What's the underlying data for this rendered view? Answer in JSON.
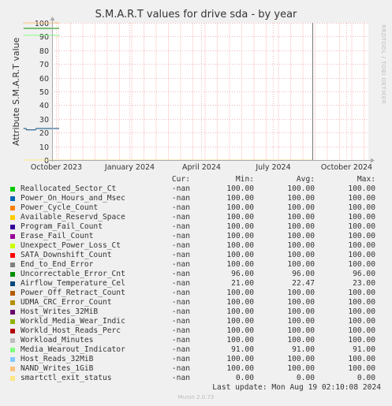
{
  "chart_data": {
    "type": "line",
    "title": "S.M.A.R.T values for drive sda - by year",
    "ylabel": "Attribute S.M.A.R.T value",
    "side_label": "RRDTOOL / TOBI OETIKER",
    "ylim": [
      0,
      100
    ],
    "yticks": [
      "0",
      "10",
      "20",
      "30",
      "40",
      "50",
      "60",
      "70",
      "80",
      "90",
      "100"
    ],
    "x_tick_labels": [
      {
        "date": "2023-10-01",
        "label": "October 2023"
      },
      {
        "date": "2024-01-01",
        "label": "January 2024"
      },
      {
        "date": "2024-04-01",
        "label": "April 2024"
      },
      {
        "date": "2024-07-01",
        "label": "July 2024"
      },
      {
        "date": "2024-10-01",
        "label": "October 2024"
      }
    ],
    "xlim": [
      "2023-08-21",
      "2024-08-19"
    ],
    "grid": true,
    "vertical_marker_date": "2024-08-19",
    "series": [
      {
        "name": "Reallocated_Sector_Ct",
        "color": "#00cc00",
        "cur": "-nan",
        "min": "100.00",
        "avg": "100.00",
        "max": "100.00",
        "points": [
          [
            "2023-08-21",
            100
          ],
          [
            "2023-10-05",
            100
          ]
        ]
      },
      {
        "name": "Power_On_Hours_and_Msec",
        "color": "#0066b3",
        "cur": "-nan",
        "min": "100.00",
        "avg": "100.00",
        "max": "100.00",
        "points": [
          [
            "2023-08-21",
            100
          ],
          [
            "2023-10-05",
            100
          ]
        ]
      },
      {
        "name": "Power_Cycle_Count",
        "color": "#ff8000",
        "cur": "-nan",
        "min": "100.00",
        "avg": "100.00",
        "max": "100.00",
        "points": [
          [
            "2023-08-21",
            100
          ],
          [
            "2023-10-05",
            100
          ]
        ]
      },
      {
        "name": "Available_Reservd_Space",
        "color": "#ffcc00",
        "cur": "-nan",
        "min": "100.00",
        "avg": "100.00",
        "max": "100.00",
        "points": [
          [
            "2023-08-21",
            100
          ],
          [
            "2023-10-05",
            100
          ]
        ]
      },
      {
        "name": "Program_Fail_Count",
        "color": "#330099",
        "cur": "-nan",
        "min": "100.00",
        "avg": "100.00",
        "max": "100.00",
        "points": [
          [
            "2023-08-21",
            100
          ],
          [
            "2023-10-05",
            100
          ]
        ]
      },
      {
        "name": "Erase_Fail_Count",
        "color": "#990099",
        "cur": "-nan",
        "min": "100.00",
        "avg": "100.00",
        "max": "100.00",
        "points": [
          [
            "2023-08-21",
            100
          ],
          [
            "2023-10-05",
            100
          ]
        ]
      },
      {
        "name": "Unexpect_Power_Loss_Ct",
        "color": "#ccff00",
        "cur": "-nan",
        "min": "100.00",
        "avg": "100.00",
        "max": "100.00",
        "points": [
          [
            "2023-08-21",
            100
          ],
          [
            "2023-10-05",
            100
          ]
        ]
      },
      {
        "name": "SATA_Downshift_Count",
        "color": "#ff0000",
        "cur": "-nan",
        "min": "100.00",
        "avg": "100.00",
        "max": "100.00",
        "points": [
          [
            "2023-08-21",
            100
          ],
          [
            "2023-10-05",
            100
          ]
        ]
      },
      {
        "name": "End_to_End_Error",
        "color": "#808080",
        "cur": "-nan",
        "min": "100.00",
        "avg": "100.00",
        "max": "100.00",
        "points": [
          [
            "2023-08-21",
            100
          ],
          [
            "2023-10-05",
            100
          ]
        ]
      },
      {
        "name": "Uncorrectable_Error_Cnt",
        "color": "#008f00",
        "cur": "-nan",
        "min": "96.00",
        "avg": "96.00",
        "max": "96.00",
        "points": [
          [
            "2023-08-21",
            96
          ],
          [
            "2023-10-05",
            96
          ]
        ]
      },
      {
        "name": "Airflow_Temperature_Cel",
        "color": "#00487d",
        "cur": "-nan",
        "min": "21.00",
        "avg": "22.47",
        "max": "23.00",
        "points": [
          [
            "2023-08-21",
            23
          ],
          [
            "2023-08-24",
            23
          ],
          [
            "2023-08-25",
            22
          ],
          [
            "2023-09-05",
            22
          ],
          [
            "2023-09-06",
            23
          ],
          [
            "2023-10-05",
            23
          ]
        ]
      },
      {
        "name": "Power_Off_Retract_Count",
        "color": "#b35a00",
        "cur": "-nan",
        "min": "100.00",
        "avg": "100.00",
        "max": "100.00",
        "points": [
          [
            "2023-08-21",
            100
          ],
          [
            "2023-10-05",
            100
          ]
        ]
      },
      {
        "name": "UDMA_CRC_Error_Count",
        "color": "#b38f00",
        "cur": "-nan",
        "min": "100.00",
        "avg": "100.00",
        "max": "100.00",
        "points": [
          [
            "2023-08-21",
            100
          ],
          [
            "2023-10-05",
            100
          ]
        ]
      },
      {
        "name": "Host_Writes_32MiB",
        "color": "#6b006b",
        "cur": "-nan",
        "min": "100.00",
        "avg": "100.00",
        "max": "100.00",
        "points": [
          [
            "2023-08-21",
            100
          ],
          [
            "2023-10-05",
            100
          ]
        ]
      },
      {
        "name": "Workld_Media_Wear_Indic",
        "color": "#8fb300",
        "cur": "-nan",
        "min": "100.00",
        "avg": "100.00",
        "max": "100.00",
        "points": [
          [
            "2023-08-21",
            100
          ],
          [
            "2023-10-05",
            100
          ]
        ]
      },
      {
        "name": "Workld_Host_Reads_Perc",
        "color": "#b30000",
        "cur": "-nan",
        "min": "100.00",
        "avg": "100.00",
        "max": "100.00",
        "points": [
          [
            "2023-08-21",
            100
          ],
          [
            "2023-10-05",
            100
          ]
        ]
      },
      {
        "name": "Workload_Minutes",
        "color": "#bebebe",
        "cur": "-nan",
        "min": "100.00",
        "avg": "100.00",
        "max": "100.00",
        "points": [
          [
            "2023-08-21",
            100
          ],
          [
            "2023-10-05",
            100
          ]
        ]
      },
      {
        "name": "Media_Wearout_Indicator",
        "color": "#80ff80",
        "cur": "-nan",
        "min": "91.00",
        "avg": "91.00",
        "max": "91.00",
        "points": [
          [
            "2023-08-21",
            91
          ],
          [
            "2023-10-05",
            91
          ]
        ]
      },
      {
        "name": "Host_Reads_32MiB",
        "color": "#80c9ff",
        "cur": "-nan",
        "min": "100.00",
        "avg": "100.00",
        "max": "100.00",
        "points": [
          [
            "2023-08-21",
            100
          ],
          [
            "2023-10-05",
            100
          ]
        ]
      },
      {
        "name": "NAND_Writes_1GiB",
        "color": "#ffc080",
        "cur": "-nan",
        "min": "100.00",
        "avg": "100.00",
        "max": "100.00",
        "points": [
          [
            "2023-08-21",
            100
          ],
          [
            "2023-10-05",
            100
          ]
        ]
      },
      {
        "name": "smartctl_exit_status",
        "color": "#ffe680",
        "cur": "-nan",
        "min": "0.00",
        "avg": "0.00",
        "max": "0.00",
        "points": [
          [
            "2023-08-21",
            0
          ],
          [
            "2024-08-19",
            0
          ]
        ]
      }
    ]
  },
  "legend": {
    "cur_header": "Cur:",
    "min_header": "Min:",
    "avg_header": "Avg:",
    "max_header": "Max:"
  },
  "footer": {
    "last_update": "Last update: Mon Aug 19 02:10:08 2024",
    "munin_version": "Munin 2.0.73"
  }
}
